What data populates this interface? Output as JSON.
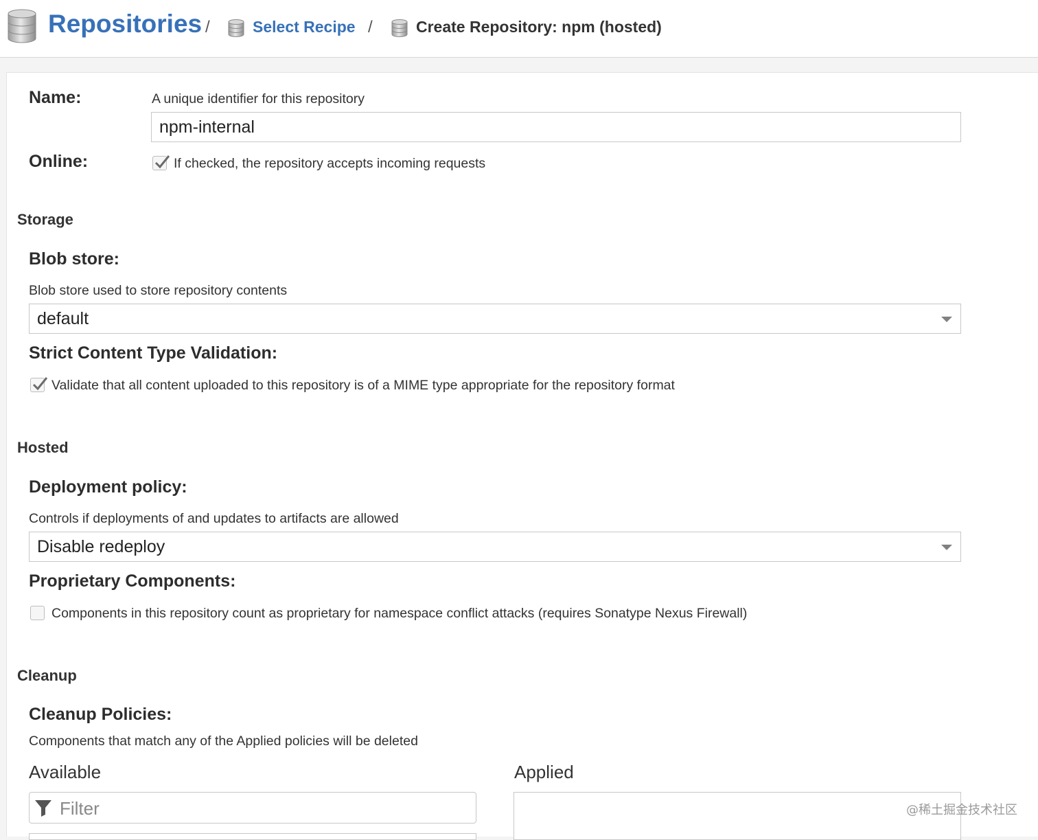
{
  "breadcrumb": {
    "root": "Repositories",
    "separator": "/",
    "step": "Select Recipe",
    "current": "Create Repository: npm (hosted)"
  },
  "form": {
    "name": {
      "label": "Name:",
      "help": "A unique identifier for this repository",
      "value": "npm-internal"
    },
    "online": {
      "label": "Online:",
      "checked": true,
      "checkbox_label": "If checked, the repository accepts incoming requests"
    },
    "storage": {
      "section_title": "Storage",
      "blob_store": {
        "label": "Blob store:",
        "help": "Blob store used to store repository contents",
        "selected": "default"
      },
      "strict_validation": {
        "label": "Strict Content Type Validation:",
        "checked": true,
        "checkbox_label": "Validate that all content uploaded to this repository is of a MIME type appropriate for the repository format"
      }
    },
    "hosted": {
      "section_title": "Hosted",
      "deployment_policy": {
        "label": "Deployment policy:",
        "help": "Controls if deployments of and updates to artifacts are allowed",
        "selected": "Disable redeploy"
      },
      "proprietary": {
        "label": "Proprietary Components:",
        "checked": false,
        "checkbox_label": "Components in this repository count as proprietary for namespace conflict attacks (requires Sonatype Nexus Firewall)"
      }
    },
    "cleanup": {
      "section_title": "Cleanup",
      "policies": {
        "label": "Cleanup Policies:",
        "help": "Components that match any of the Applied policies will be deleted",
        "available_label": "Available",
        "applied_label": "Applied",
        "filter_placeholder": "Filter"
      }
    }
  },
  "icons": {
    "repository": "database-icon",
    "filter": "filter-icon",
    "check": "check-icon",
    "dropdown": "chevron-down-icon"
  },
  "colors": {
    "accent": "#3771b8",
    "border": "#c7c7c7"
  },
  "watermark": "@稀土掘金技术社区"
}
